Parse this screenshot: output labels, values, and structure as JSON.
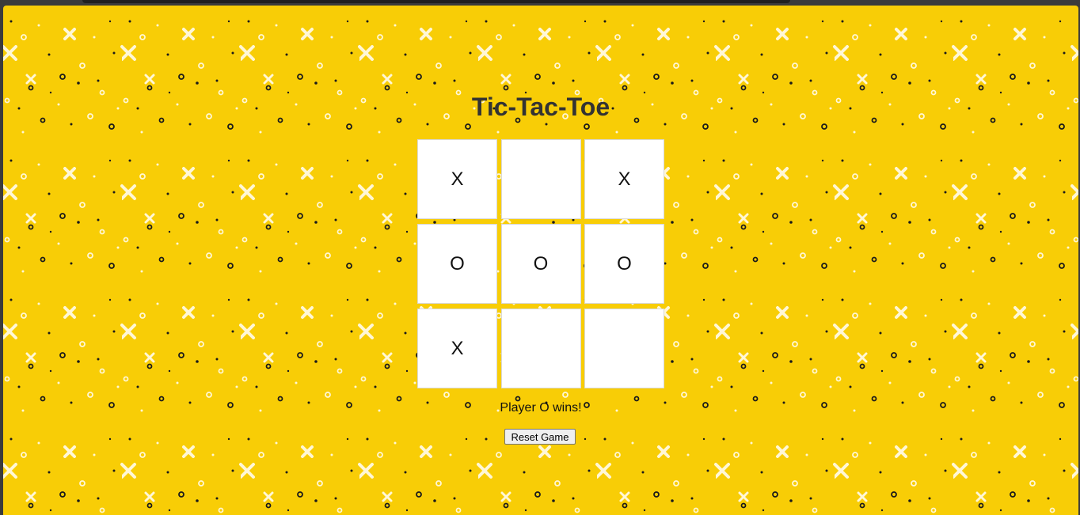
{
  "game": {
    "title": "Tic-Tac-Toe",
    "board": [
      "X",
      "",
      "X",
      "O",
      "O",
      "O",
      "X",
      "",
      ""
    ],
    "status": "Player O wins!",
    "reset_label": "Reset Game"
  },
  "theme": {
    "background": "#f8cd06",
    "pattern_icons": [
      "x-mark-icon",
      "o-ring-icon",
      "dot-icon"
    ]
  }
}
